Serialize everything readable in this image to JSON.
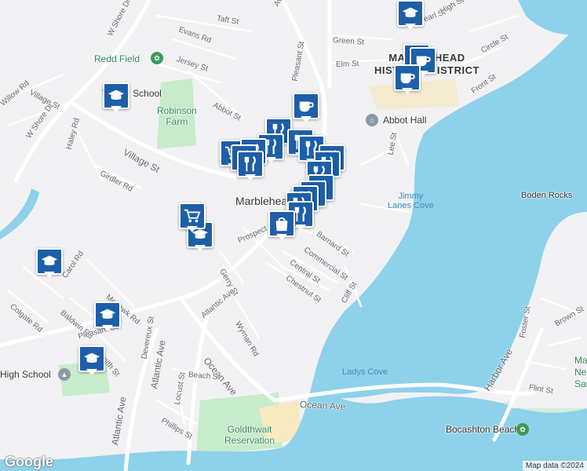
{
  "map": {
    "street_labels": [
      "Taft St",
      "Evans Rd",
      "W Shore Dr",
      "Jersey St",
      "Green St",
      "Elm St",
      "Pearl St",
      "High St",
      "Circle St",
      "Willow Rd",
      "Village St",
      "Abbot St",
      "Pleasant St",
      "Front St",
      "Lee St",
      "Haley Rd",
      "Village St",
      "W Shore Dr",
      "Girdler Rd",
      "Prospect St",
      "Barnard St",
      "Commercial St",
      "Central St",
      "Chestnut St",
      "Cliff St",
      "Gerry St",
      "Mohawk Rd",
      "Atlantic Ave",
      "Wyman Rd",
      "Carol Rd",
      "Colgate Rd",
      "Baldwin Rd",
      "Pleasant St",
      "Smith St",
      "Devereux St",
      "Atlantic Ave",
      "Ocean Ave",
      "Beach St",
      "Locust St",
      "Phillips St",
      "Ocean Ave",
      "Atlantic Ave",
      "Harbor Ave",
      "Foster St",
      "Brown St",
      "Flint St",
      "Ave"
    ],
    "poi_labels": {
      "redd_field": "Redd Field",
      "village_school": "Village School",
      "robinson_farm": "Robinson\nFarm",
      "abbot_hall": "Abbot Hall",
      "goldthwait": "Goldthwait\nReservation",
      "bocashton": "Bocashton Beach",
      "high_school": "High School",
      "marblehead_neck": "Marbl\nNeck W\nSanc"
    },
    "district_label": "MARBLEHEAD\nHISTORIC DISTRICT",
    "town_label": "Marblehead",
    "water_labels": {
      "jimmy_lanes": "Jimmy\nLanes Cove",
      "ladys_cove": "Ladys Cove",
      "boden_rocks": "Boden Rocks"
    },
    "attribution": "Map data ©2024",
    "logo": "Google",
    "colors": {
      "water": "#8ed1eb",
      "land": "#f2f2f4",
      "park": "#c7ebcb",
      "road": "#ffffff",
      "sand": "#f8eac0",
      "marker": "#1d5fa8"
    }
  }
}
